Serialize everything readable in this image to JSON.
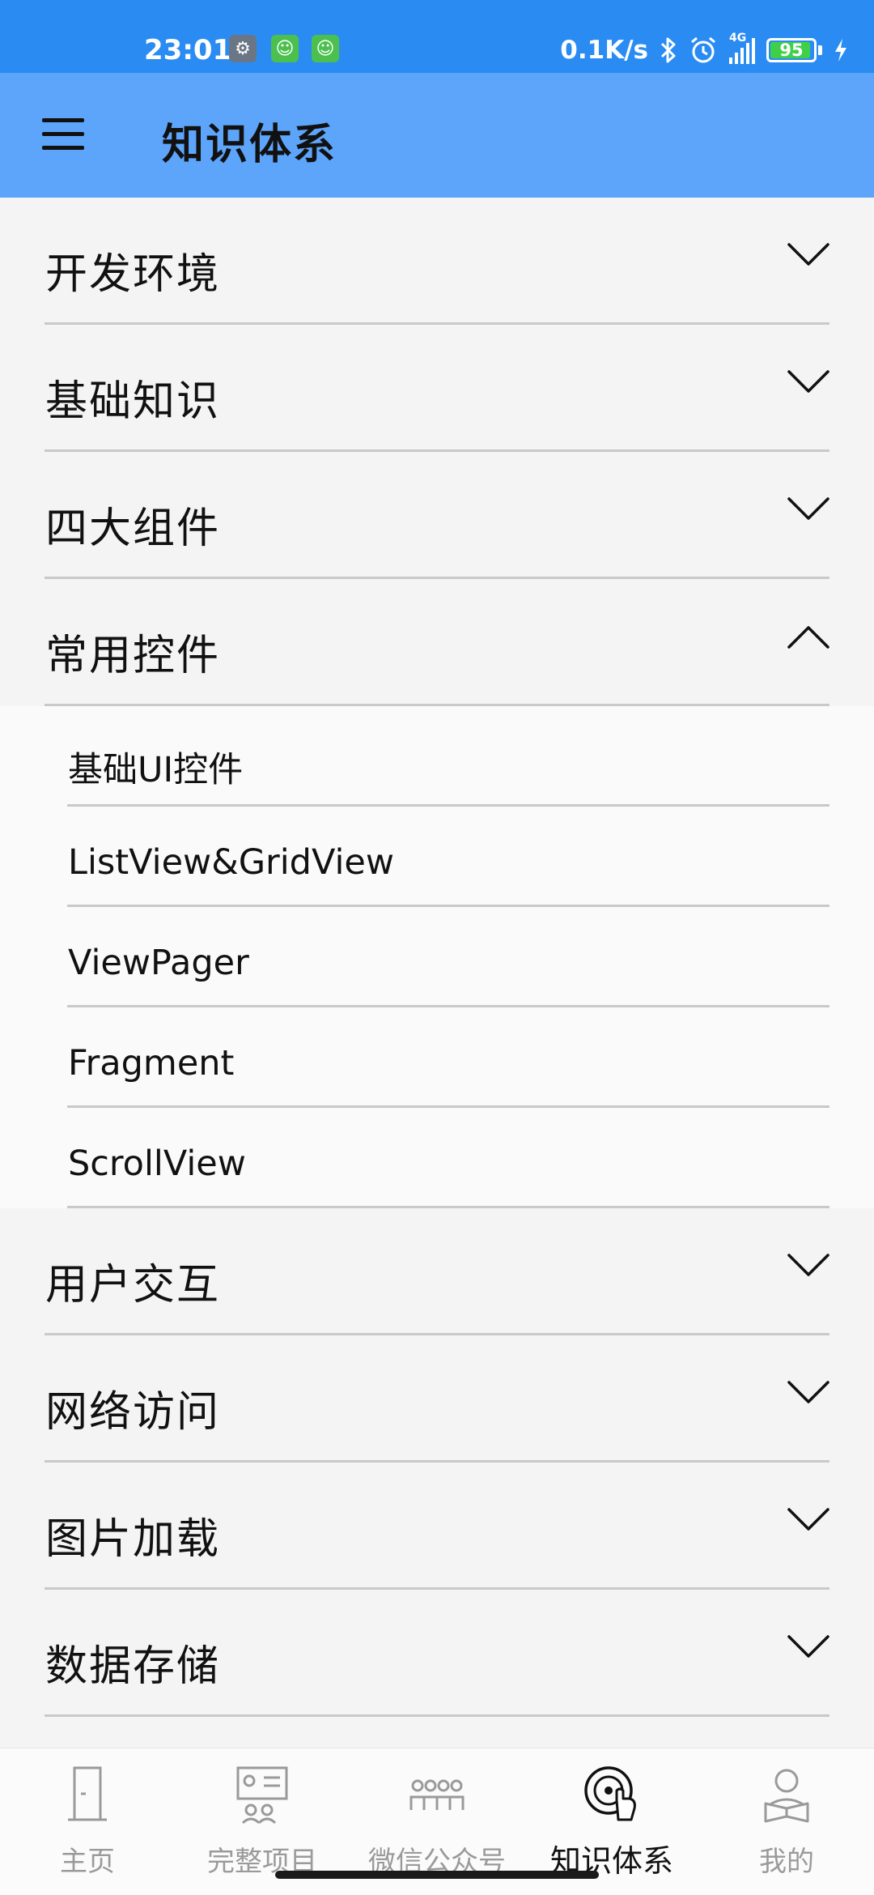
{
  "status_bar": {
    "time": "23:01",
    "network_speed": "0.1K/s",
    "signal_type": "4G",
    "battery_level": "95",
    "battery_percent": 95,
    "icons": [
      "settings-icon",
      "app-notification-icon",
      "app-notification-icon",
      "bluetooth-icon",
      "alarm-icon",
      "signal-icon",
      "battery-icon",
      "charging-icon"
    ]
  },
  "app_bar": {
    "title": "知识体系",
    "menu_icon": "hamburger-menu-icon"
  },
  "categories": [
    {
      "label": "开发环境",
      "expanded": false
    },
    {
      "label": "基础知识",
      "expanded": false
    },
    {
      "label": "四大组件",
      "expanded": false
    },
    {
      "label": "常用控件",
      "expanded": true,
      "children": [
        "基础UI控件",
        "ListView&GridView",
        "ViewPager",
        "Fragment",
        "ScrollView"
      ]
    },
    {
      "label": "用户交互",
      "expanded": false
    },
    {
      "label": "网络访问",
      "expanded": false
    },
    {
      "label": "图片加载",
      "expanded": false
    },
    {
      "label": "数据存储",
      "expanded": false
    }
  ],
  "bottom_nav": {
    "items": [
      {
        "label": "主页",
        "icon": "door-icon",
        "active": false
      },
      {
        "label": "完整项目",
        "icon": "presentation-board-icon",
        "active": false
      },
      {
        "label": "微信公众号",
        "icon": "group-people-icon",
        "active": false
      },
      {
        "label": "知识体系",
        "icon": "hand-disc-icon",
        "active": true
      },
      {
        "label": "我的",
        "icon": "reader-person-icon",
        "active": false
      }
    ]
  },
  "colors": {
    "status_bar": "#2a8cf3",
    "app_bar": "#5da5fb",
    "battery_green": "#3fd04a",
    "divider": "#c9c9c9",
    "inactive_nav": "#9a9a9a"
  }
}
